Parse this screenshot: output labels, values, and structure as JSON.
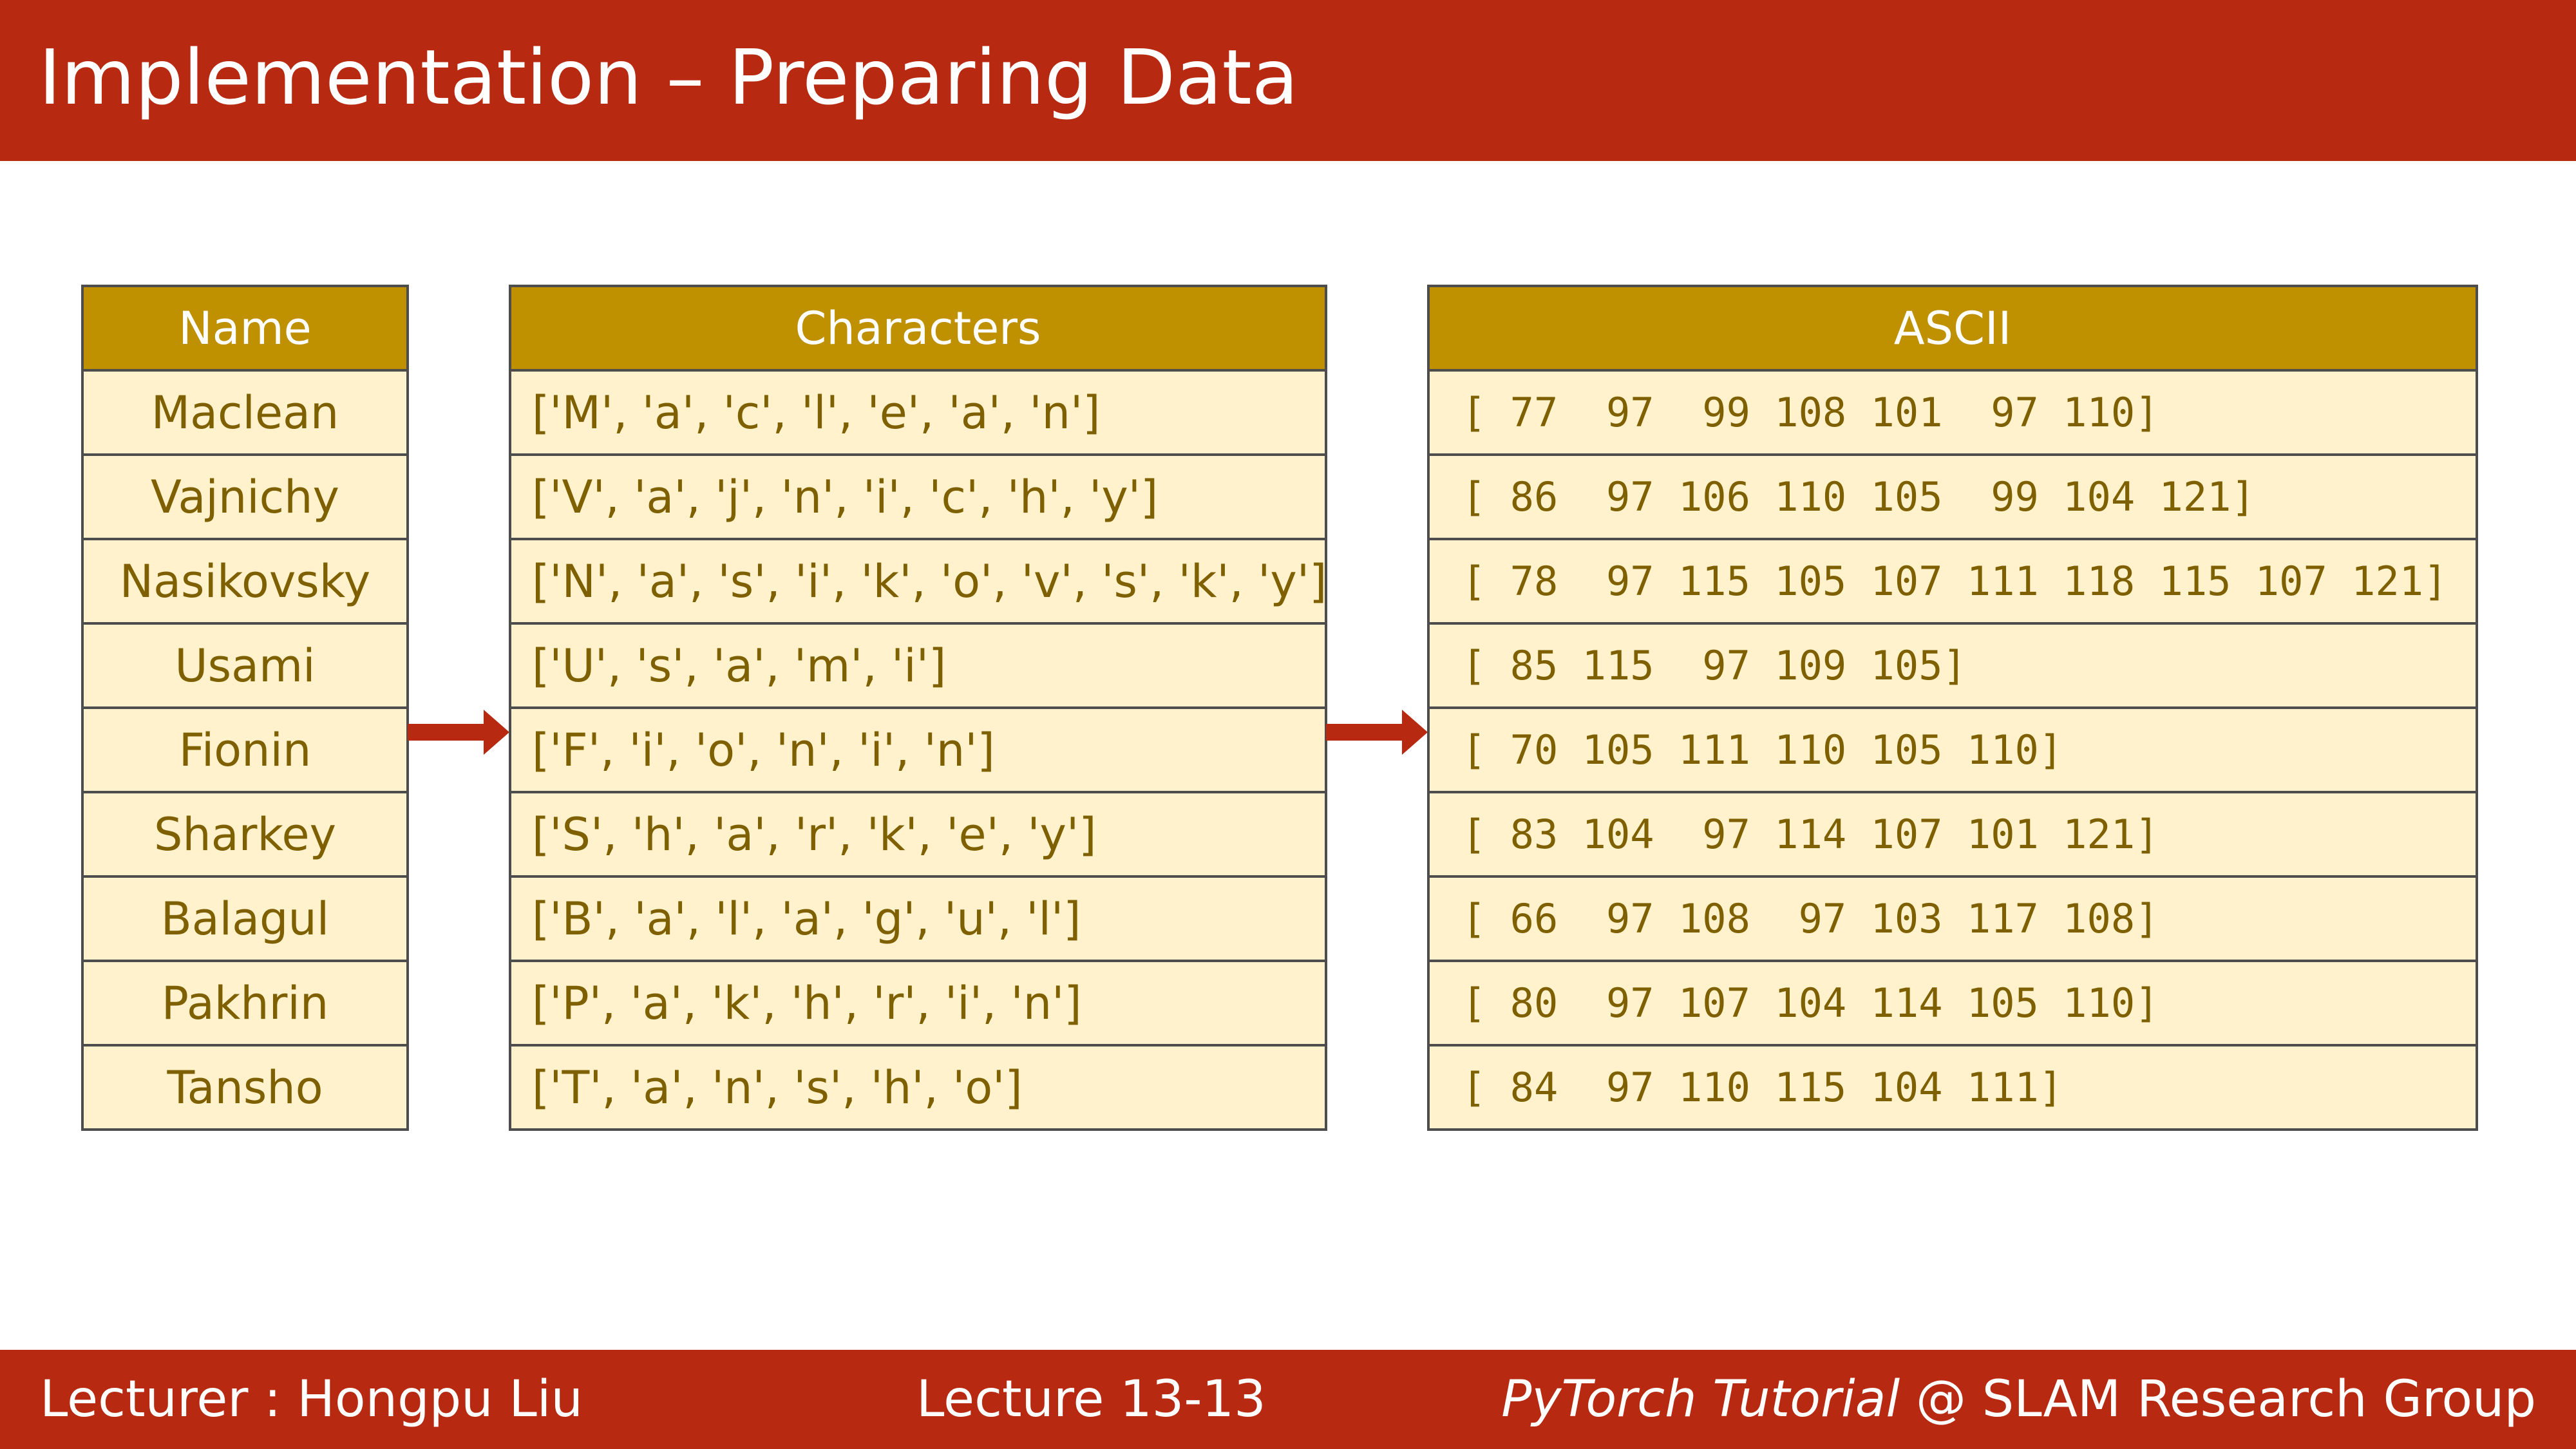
{
  "title": "Implementation – Preparing Data",
  "columns": {
    "name": "Name",
    "characters": "Characters",
    "ascii": "ASCII"
  },
  "rows": [
    {
      "name": "Maclean",
      "characters": "['M', 'a', 'c', 'l', 'e', 'a', 'n']",
      "ascii": "[ 77  97  99 108 101  97 110]"
    },
    {
      "name": "Vajnichy",
      "characters": "['V', 'a', 'j', 'n', 'i', 'c', 'h', 'y']",
      "ascii": "[ 86  97 106 110 105  99 104 121]"
    },
    {
      "name": "Nasikovsky",
      "characters": "['N', 'a', 's', 'i', 'k', 'o', 'v', 's', 'k', 'y']",
      "ascii": "[ 78  97 115 105 107 111 118 115 107 121]"
    },
    {
      "name": "Usami",
      "characters": "['U', 's', 'a', 'm', 'i']",
      "ascii": "[ 85 115  97 109 105]"
    },
    {
      "name": "Fionin",
      "characters": "['F', 'i', 'o', 'n', 'i', 'n']",
      "ascii": "[ 70 105 111 110 105 110]"
    },
    {
      "name": "Sharkey",
      "characters": "['S', 'h', 'a', 'r', 'k', 'e', 'y']",
      "ascii": "[ 83 104  97 114 107 101 121]"
    },
    {
      "name": "Balagul",
      "characters": "['B', 'a', 'l', 'a', 'g', 'u', 'l']",
      "ascii": "[ 66  97 108  97 103 117 108]"
    },
    {
      "name": "Pakhrin",
      "characters": "['P', 'a', 'k', 'h', 'r', 'i', 'n']",
      "ascii": "[ 80  97 107 104 114 105 110]"
    },
    {
      "name": "Tansho",
      "characters": "['T', 'a', 'n', 's', 'h', 'o']",
      "ascii": "[ 84  97 110 115 104 111]"
    }
  ],
  "footer": {
    "lecturer": "Lecturer : Hongpu Liu",
    "lecture": "Lecture 13-13",
    "course_italic": "PyTorch Tutorial",
    "course_rest": " @ SLAM Research Group"
  },
  "colors": {
    "title_bar": "#b72a11",
    "header_fill": "#bf9000",
    "cell_fill": "#fff2cc",
    "cell_text": "#7f6000",
    "arrow": "#b72a11"
  }
}
